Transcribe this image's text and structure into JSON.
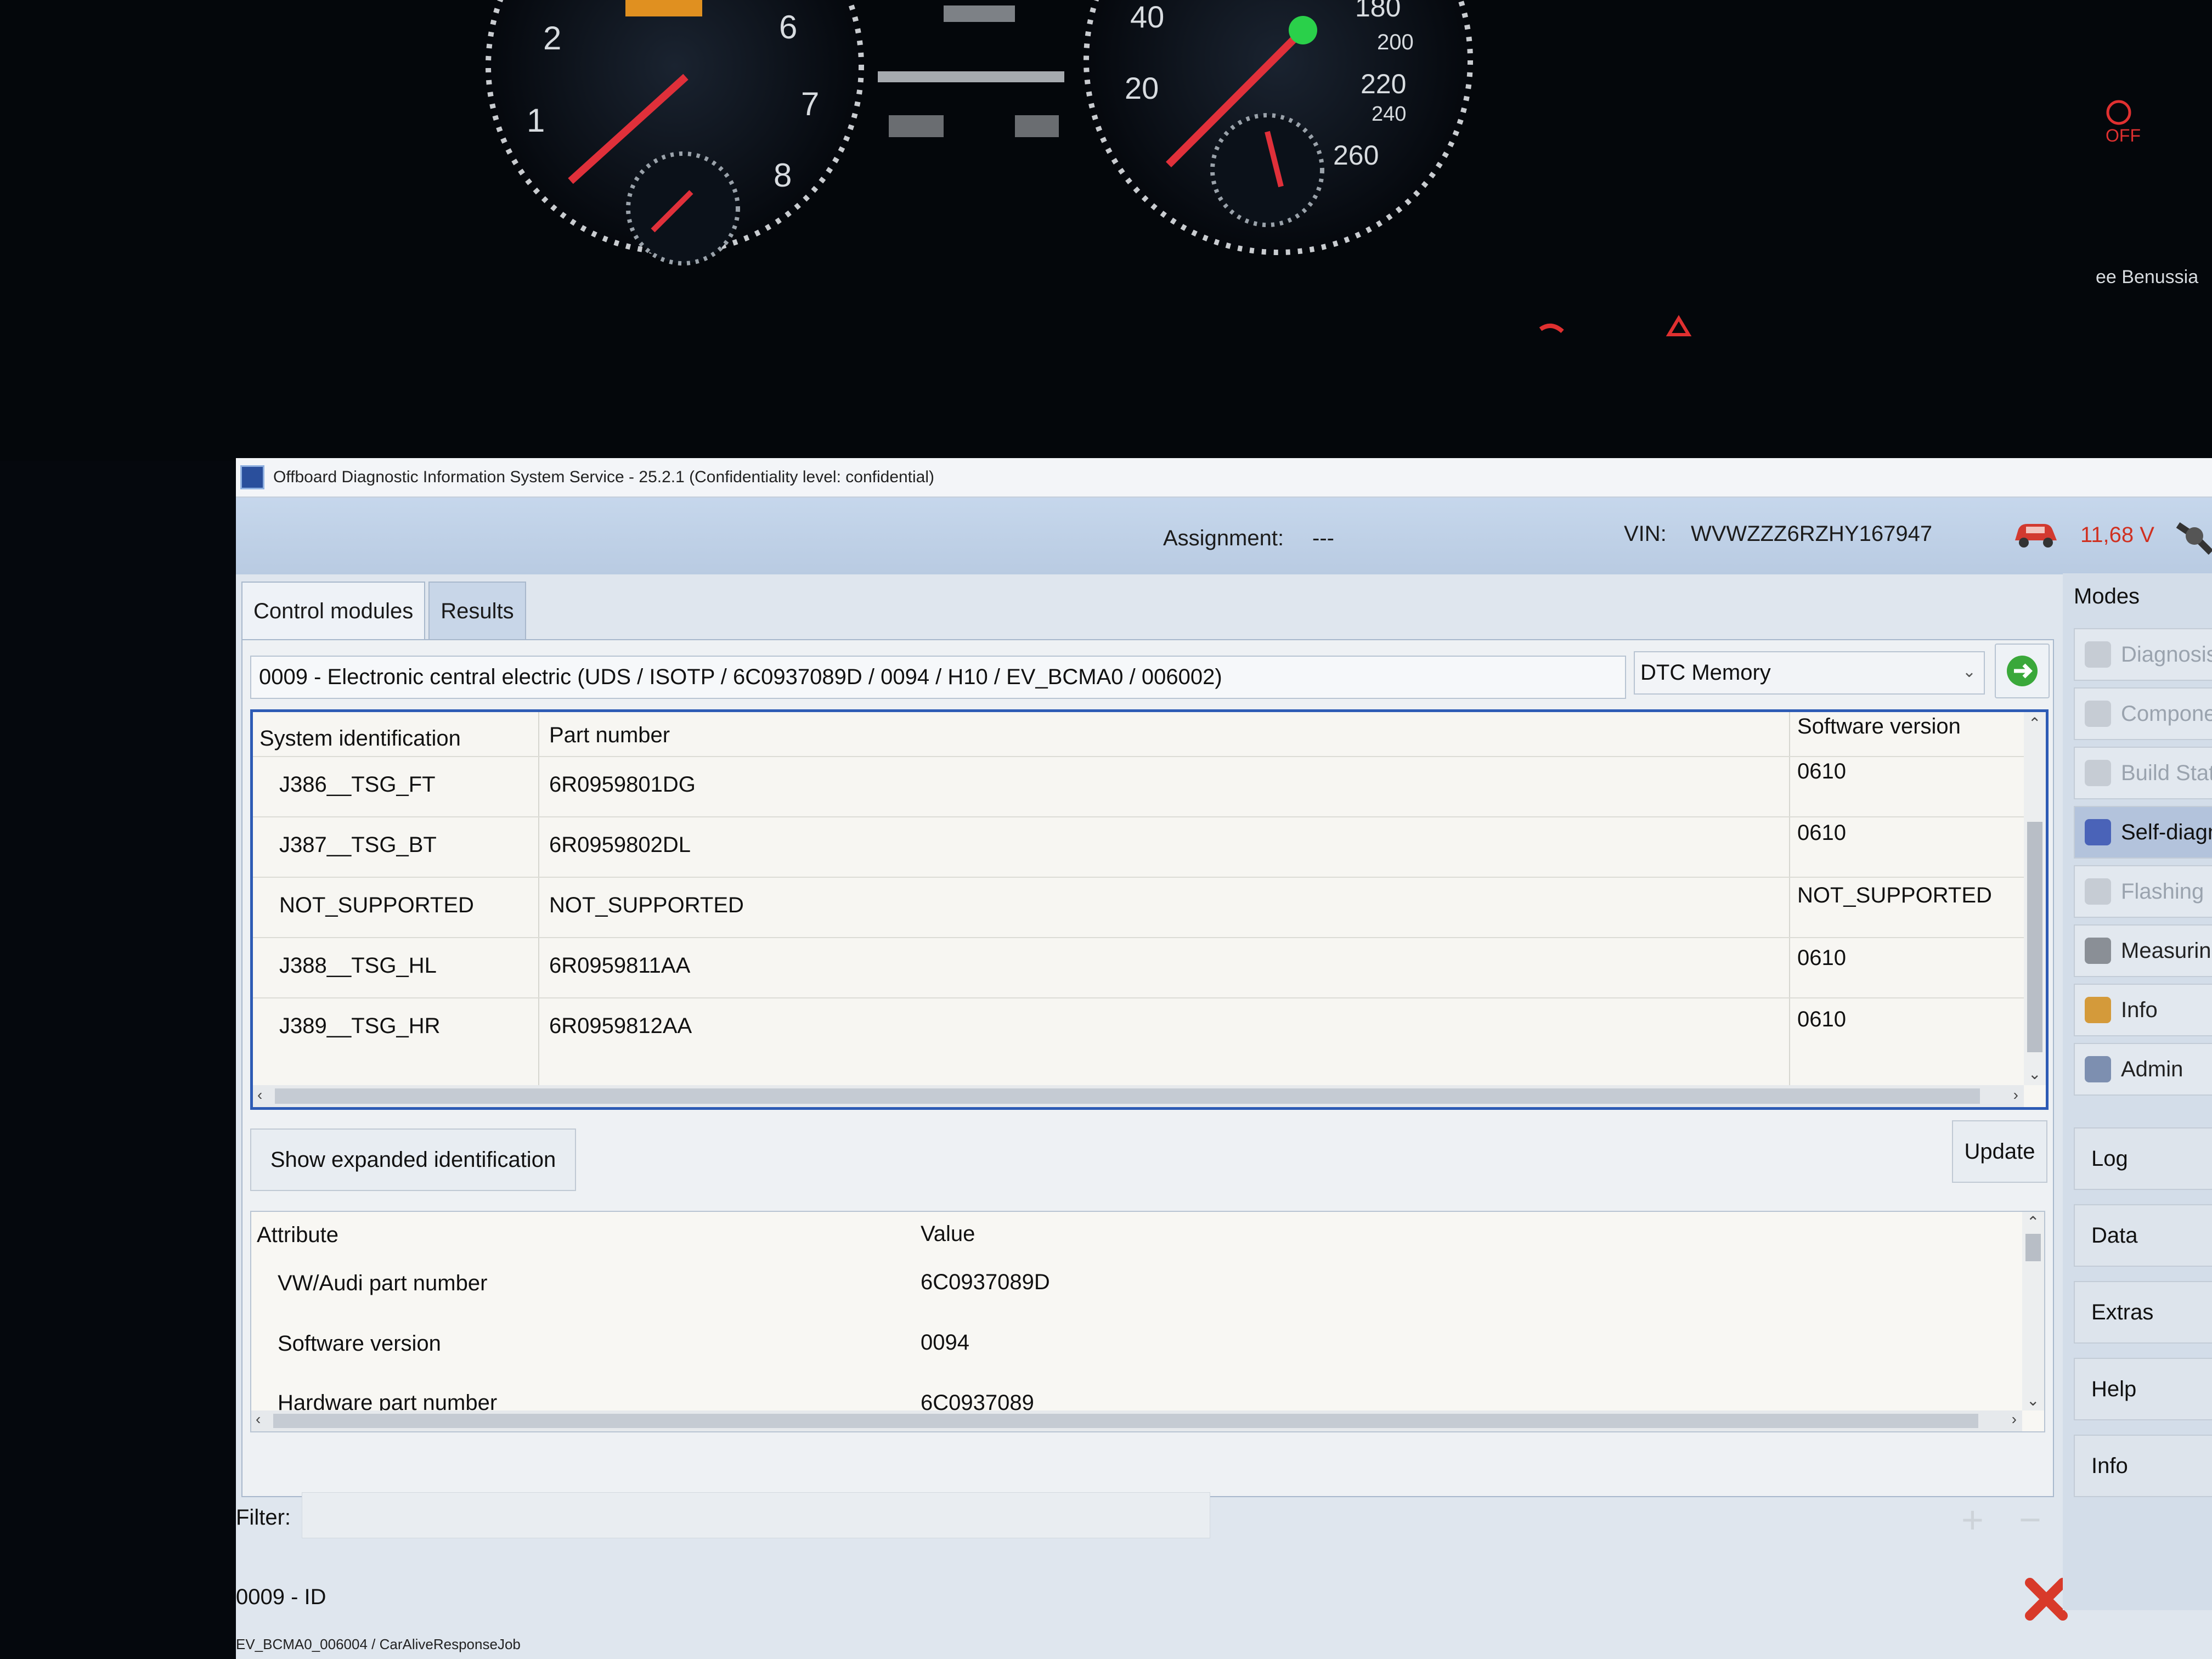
{
  "cluster": {
    "tacho_labels": [
      "2",
      "1",
      "6",
      "7",
      "8"
    ],
    "speedo_labels": [
      "40",
      "20",
      "180",
      "200",
      "220",
      "240",
      "260"
    ],
    "airbag_off": "OFF",
    "display_text": "ee Benussia"
  },
  "window": {
    "title": "Offboard Diagnostic Information System Service - 25.2.1 (Confidentiality level: confidential)"
  },
  "header": {
    "assignment_label": "Assignment:",
    "assignment_value": "---",
    "vin_label": "VIN:",
    "vin_value": "WVWZZZ6RZHY167947",
    "voltage": "11,68 V"
  },
  "tabs": [
    {
      "label": "Control modules"
    },
    {
      "label": "Results"
    }
  ],
  "module": {
    "name": "0009 - Electronic central electric  (UDS / ISOTP / 6C0937089D / 0094 / H10 / EV_BCMA0 / 006002)",
    "selected_function": "DTC Memory"
  },
  "ident_table": {
    "headers": [
      "System identification",
      "Part number",
      "Software version"
    ],
    "rows": [
      [
        "J386__TSG_FT",
        "6R0959801DG",
        "0610"
      ],
      [
        "J387__TSG_BT",
        "6R0959802DL",
        "0610"
      ],
      [
        "NOT_SUPPORTED",
        "NOT_SUPPORTED",
        "NOT_SUPPORTED"
      ],
      [
        "J388__TSG_HL",
        "6R0959811AA",
        "0610"
      ],
      [
        "J389__TSG_HR",
        "6R0959812AA",
        "0610"
      ]
    ]
  },
  "buttons": {
    "show_expanded": "Show expanded identification",
    "update": "Update"
  },
  "attr_table": {
    "headers": [
      "Attribute",
      "Value"
    ],
    "rows": [
      [
        "VW/Audi part number",
        "6C0937089D"
      ],
      [
        "Software version",
        "0094"
      ],
      [
        "Hardware part number",
        "6C0937089"
      ]
    ]
  },
  "filter": {
    "label": "Filter:",
    "value": ""
  },
  "status": {
    "text": "0009 - ID",
    "job": "EV_BCMA0_006004 / CarAliveResponseJob"
  },
  "modes": {
    "title": "Modes",
    "items": [
      {
        "label": "Diagnosis",
        "icon": "diagnosis-icon",
        "state": "dim"
      },
      {
        "label": "Components",
        "icon": "components-icon",
        "state": "dim"
      },
      {
        "label": "Build State",
        "icon": "build-state-icon",
        "state": "dim"
      },
      {
        "label": "Self-diagnosis",
        "icon": "self-diagnosis-icon",
        "state": "active"
      },
      {
        "label": "Flashing",
        "icon": "flashing-icon",
        "state": "dim"
      },
      {
        "label": "Measuring",
        "icon": "measuring-icon",
        "state": "normal"
      },
      {
        "label": "Info",
        "icon": "info-book-icon",
        "state": "normal"
      },
      {
        "label": "Admin",
        "icon": "admin-icon",
        "state": "normal"
      }
    ],
    "side_buttons": [
      "Log",
      "Data",
      "Extras",
      "Help",
      "Info"
    ]
  },
  "colors": {
    "accent_blue": "#2d5bb5",
    "voltage_red": "#d03020",
    "cancel_red": "#d83a2a",
    "go_green": "#3aa83a"
  }
}
